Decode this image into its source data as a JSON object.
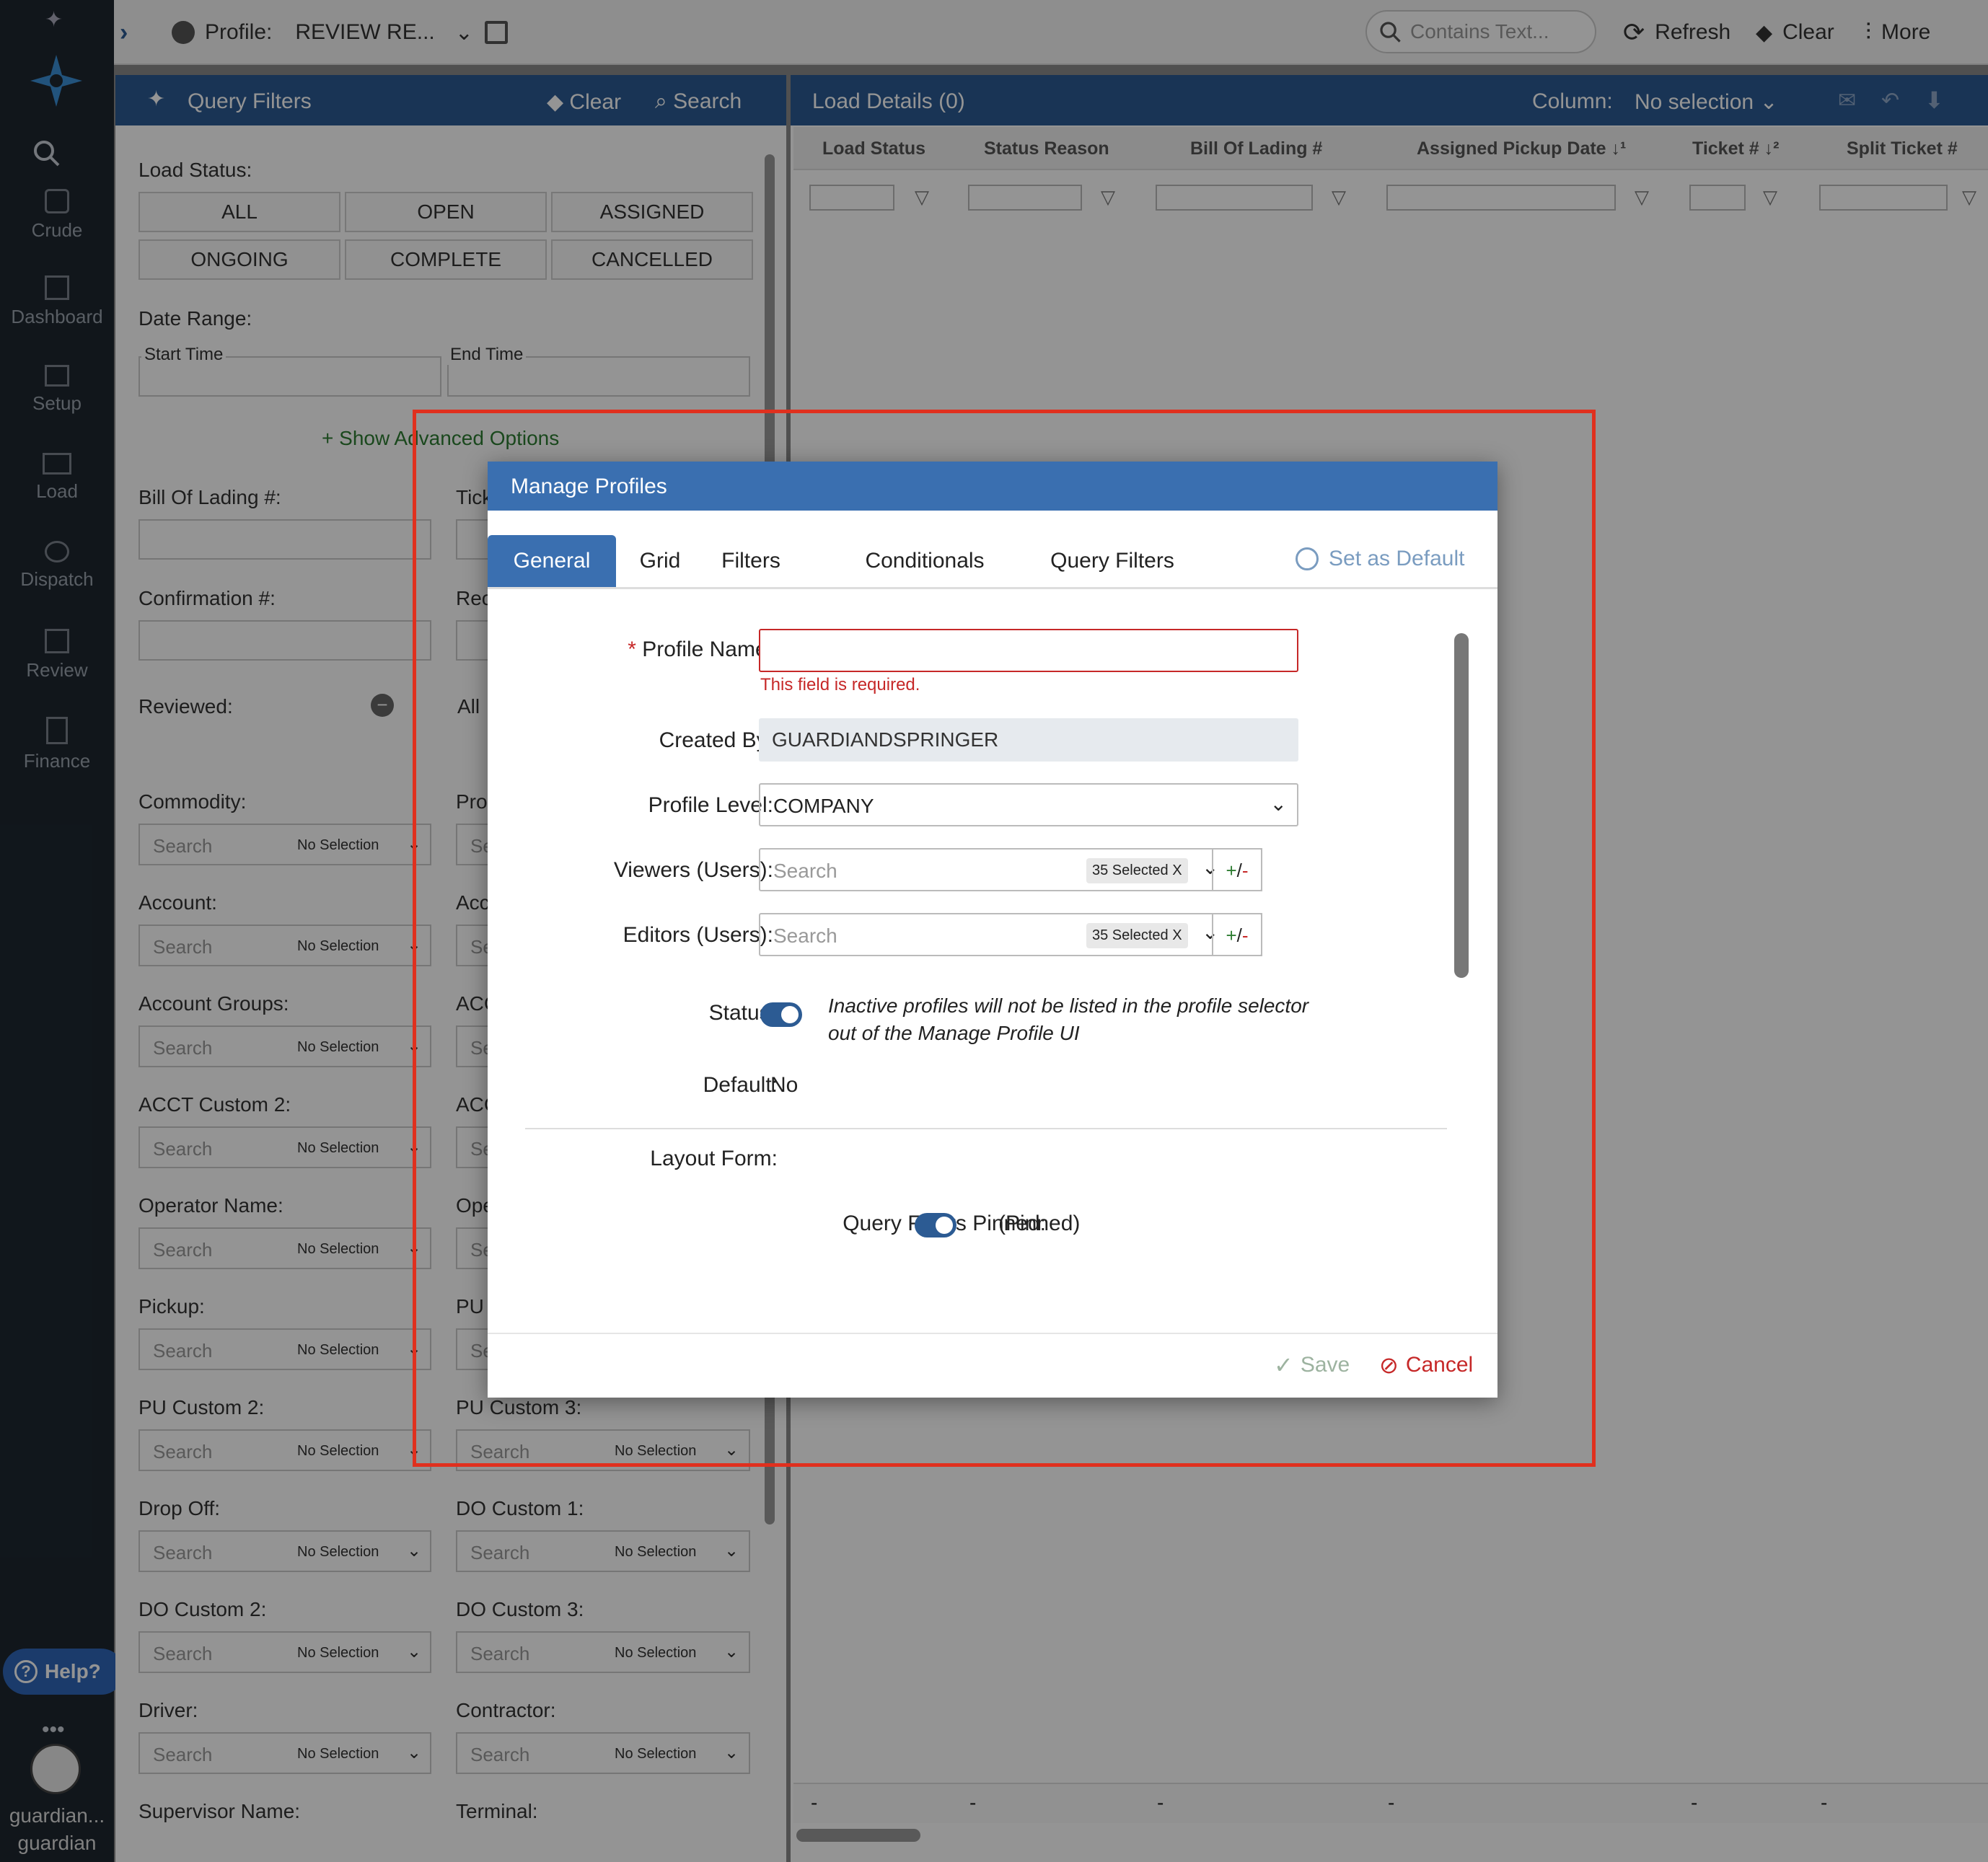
{
  "nav": {
    "items": [
      {
        "label": "Crude",
        "icon": "crude-icon"
      },
      {
        "label": "Dashboard",
        "icon": "dashboard-icon"
      },
      {
        "label": "Setup",
        "icon": "setup-icon"
      },
      {
        "label": "Load",
        "icon": "load-icon"
      },
      {
        "label": "Dispatch",
        "icon": "dispatch-icon"
      },
      {
        "label": "Review",
        "icon": "review-icon"
      },
      {
        "label": "Finance",
        "icon": "finance-icon"
      }
    ],
    "help_label": "Help?",
    "user_line1": "guardian...",
    "user_line2": "guardian"
  },
  "topbar": {
    "profile_label": "Profile:",
    "profile_value": "REVIEW RE...",
    "search_placeholder": "Contains Text...",
    "refresh_label": "Refresh",
    "clear_label": "Clear",
    "more_label": "More"
  },
  "query_filters": {
    "title": "Query Filters",
    "clear_label": "Clear",
    "search_label": "Search",
    "load_status_label": "Load Status:",
    "status_buttons": [
      "ALL",
      "OPEN",
      "ASSIGNED",
      "ONGOING",
      "COMPLETE",
      "CANCELLED"
    ],
    "date_range_label": "Date Range:",
    "start_time_label": "Start Time",
    "end_time_label": "End Time",
    "advanced_label": "Show Advanced Options",
    "bol_label": "Bill Of Lading #:",
    "ticket_label_partial": "Tick",
    "confirmation_label": "Confirmation #:",
    "rec_label_partial": "Rec",
    "reviewed_label": "Reviewed:",
    "all_partial": "All",
    "search_placeholder": "Search",
    "no_selection": "No Selection",
    "left_fields": [
      "Commodity:",
      "Account:",
      "Account Groups:",
      "ACCT Custom 2:",
      "Operator Name:",
      "Pickup:",
      "PU Custom 2:",
      "Drop Off:",
      "DO Custom 2:",
      "Driver:",
      "Supervisor Name:"
    ],
    "right_fields": [
      "Pro",
      "Acc",
      "ACC",
      "ACC",
      "Ope",
      "PU",
      "PU Custom 3:",
      "DO Custom 1:",
      "DO Custom 3:",
      "Contractor:",
      "Terminal:"
    ],
    "right_search_partial": "Se"
  },
  "grid": {
    "title": "Load Details (0)",
    "column_label": "Column:",
    "column_value": "No selection",
    "columns": [
      "Load Status",
      "Status Reason",
      "Bill Of Lading #",
      "Assigned Pickup Date ↓¹",
      "Ticket # ↓²",
      "Split Ticket #"
    ],
    "footer_dash": "-"
  },
  "modal": {
    "title": "Manage Profiles",
    "tabs": [
      "General",
      "Grid",
      "Filters",
      "Conditionals",
      "Query Filters"
    ],
    "active_tab": "General",
    "set_default_label": "Set as Default",
    "required_mark": "*",
    "profile_name_label": "Profile Name:",
    "profile_name_value": "",
    "error_text": "This field is required.",
    "created_by_label": "Created By:",
    "created_by_value": "GUARDIANDSPRINGER",
    "profile_level_label": "Profile Level:",
    "profile_level_value": "COMPANY",
    "viewers_label": "Viewers (Users):",
    "editors_label": "Editors (Users):",
    "search_placeholder": "Search",
    "selected_chip": "35 Selected X",
    "plus": "+",
    "slash": "/",
    "minus": "-",
    "status_label": "Status:",
    "status_note": "Inactive profiles will not be listed in the profile selector out of the Manage Profile UI",
    "default_label": "Default:",
    "default_value": "No",
    "layout_form_label": "Layout Form:",
    "qf_pinned_label": "Query Filters Pinned:",
    "qf_pinned_value": "(Pinned)",
    "save_label": "Save",
    "cancel_label": "Cancel",
    "colors": {
      "header": "#3a6fb0",
      "error": "#c62828",
      "toggle": "#2c5b93"
    }
  }
}
